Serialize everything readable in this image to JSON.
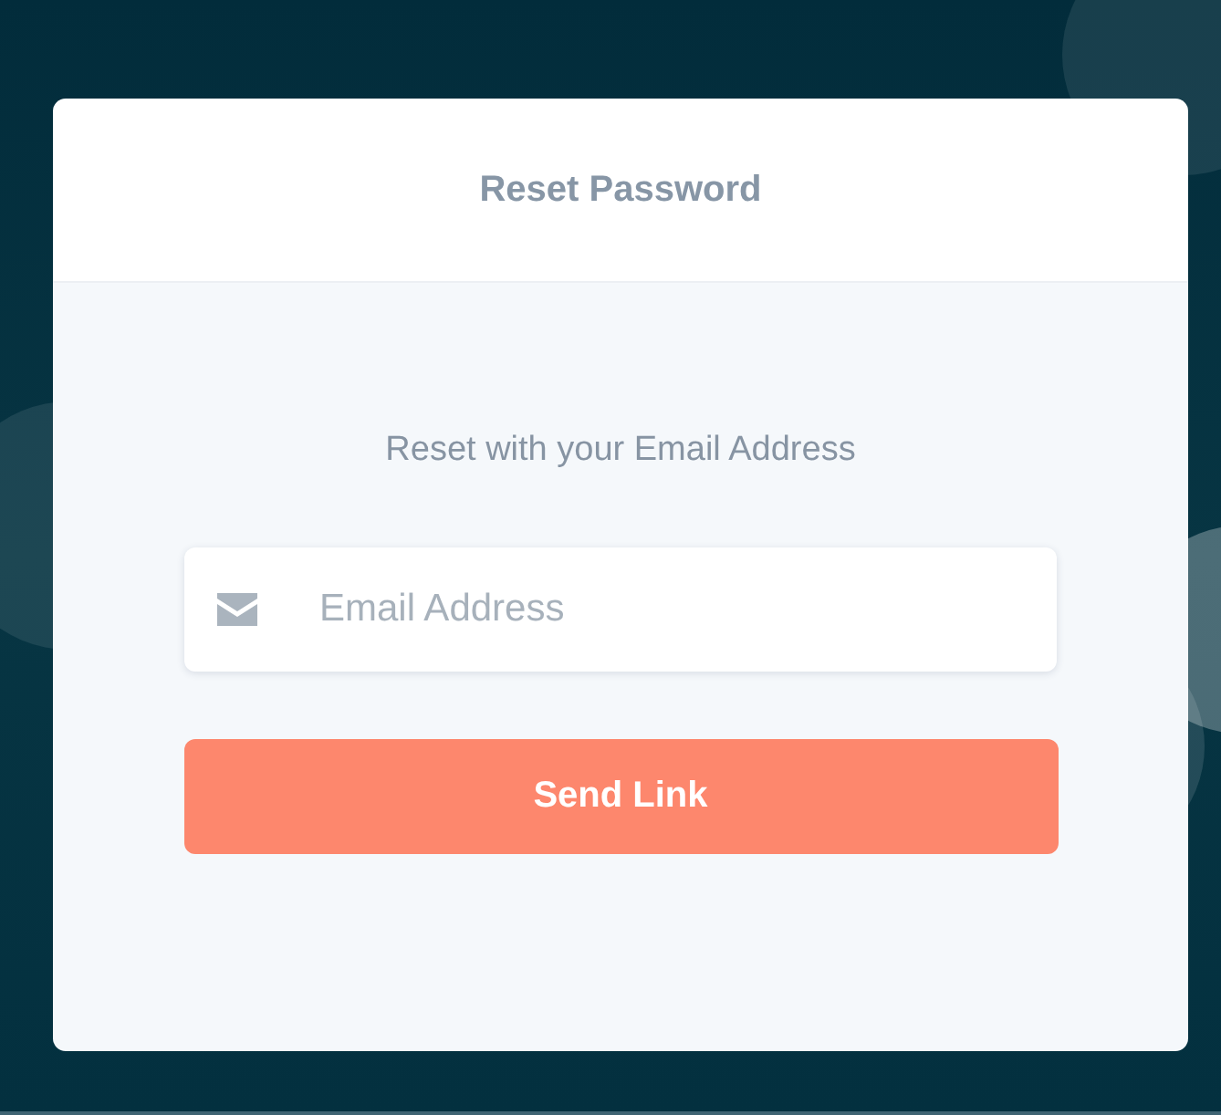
{
  "card": {
    "title": "Reset Password",
    "subtitle": "Reset with your Email Address"
  },
  "email_field": {
    "placeholder": "Email Address"
  },
  "buttons": [
    {
      "label": "Send Link"
    }
  ]
}
